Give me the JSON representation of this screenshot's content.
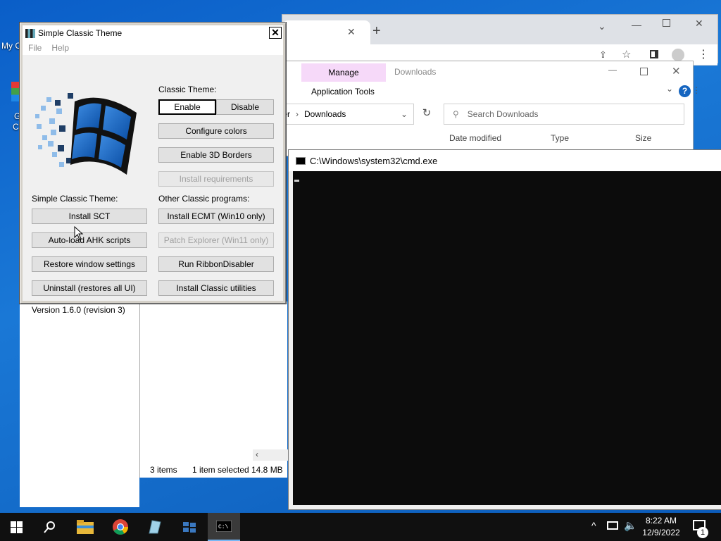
{
  "desktop": {
    "label_fragment": "My C",
    "icon2_label_a": "G",
    "icon2_label_b": "C"
  },
  "browser": {
    "new_tab_icon": "+"
  },
  "explorer": {
    "manage_tab": "Manage",
    "downloads_title": "Downloads",
    "application_tools": "Application Tools",
    "view_fragment": "v",
    "breadcrumb_prefix": "ter",
    "breadcrumb_current": "Downloads",
    "search_placeholder": "Search Downloads",
    "columns": [
      "Date modified",
      "Type",
      "Size"
    ],
    "status": {
      "items": "3 items",
      "selected": "1 item selected",
      "size": "14.8 MB"
    }
  },
  "cmd": {
    "title": "C:\\Windows\\system32\\cmd.exe"
  },
  "sct": {
    "title": "Simple Classic Theme",
    "menu": [
      "File",
      "Help"
    ],
    "classic_theme_label": "Classic Theme:",
    "enable": "Enable",
    "disable": "Disable",
    "configure_colors": "Configure colors",
    "enable_3d_borders": "Enable 3D Borders",
    "install_requirements": "Install requirements",
    "sct_label": "Simple Classic Theme:",
    "other_label": "Other Classic programs:",
    "install_sct": "Install SCT",
    "autoload_ahk": "Auto-load AHK scripts",
    "restore_window": "Restore window settings",
    "uninstall": "Uninstall (restores all UI)",
    "install_ecmt": "Install ECMT (Win10 only)",
    "patch_explorer": "Patch Explorer (Win11 only)",
    "run_ribbon": "Run RibbonDisabler",
    "install_utilities": "Install Classic utilities",
    "version": "Version 1.6.0 (revision 3)"
  },
  "taskbar": {
    "time": "8:22 AM",
    "date": "12/9/2022",
    "notification_count": "1",
    "pinned": [
      "start-icon",
      "search-icon",
      "file-explorer-icon",
      "chrome-icon",
      "classic-utility-icon",
      "sct-icon",
      "cmd-icon"
    ]
  }
}
